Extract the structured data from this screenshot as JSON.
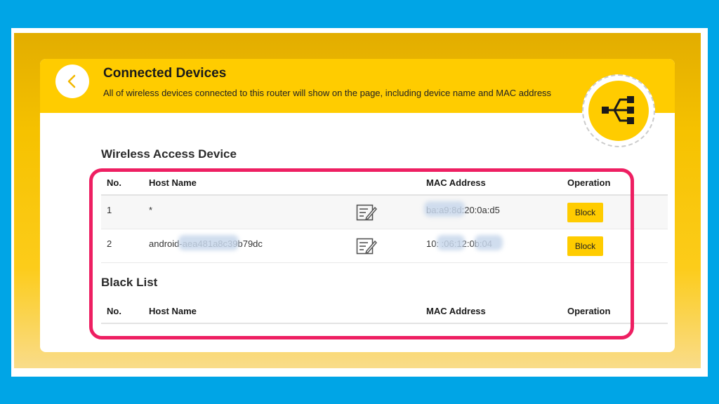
{
  "header": {
    "title": "Connected Devices",
    "description": "All of wireless devices connected to this router will show on the page, including device name and MAC address"
  },
  "wireless": {
    "section_title": "Wireless Access Device",
    "columns": {
      "no": "No.",
      "host": "Host Name",
      "mac": "MAC Address",
      "op": "Operation"
    },
    "rows": [
      {
        "no": "1",
        "host": "*",
        "mac": "ba:a9:8d:20:0a:d5",
        "action": "Block"
      },
      {
        "no": "2",
        "host": "android-aea481a8c39b79dc",
        "mac": "10:  :06:12:0b:04",
        "action": "Block"
      }
    ]
  },
  "blacklist": {
    "section_title": "Black List",
    "columns": {
      "no": "No.",
      "host": "Host Name",
      "mac": "MAC Address",
      "op": "Operation"
    }
  },
  "icons": {
    "back": "chevron-left-icon",
    "hero": "network-split-icon",
    "edit": "edit-note-icon"
  },
  "colors": {
    "accent": "#ffcc00",
    "background": "#00a5e6",
    "highlight": "#ee1f62"
  }
}
